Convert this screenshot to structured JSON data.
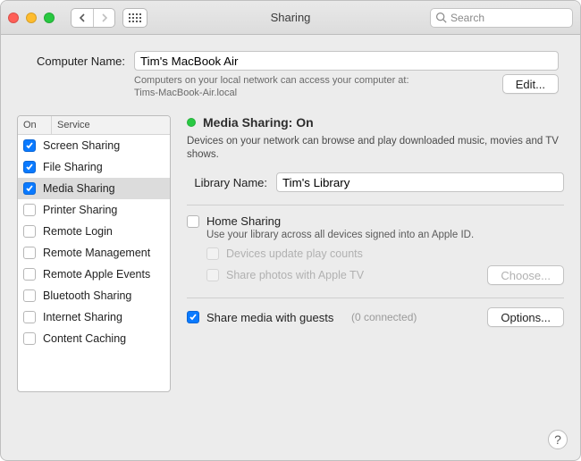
{
  "window": {
    "title": "Sharing",
    "search_placeholder": "Search"
  },
  "computer_name": {
    "label": "Computer Name:",
    "value": "Tim's MacBook Air",
    "sub1": "Computers on your local network can access your computer at:",
    "sub2": "Tims-MacBook-Air.local",
    "edit": "Edit..."
  },
  "services": {
    "col_on": "On",
    "col_service": "Service",
    "items": [
      {
        "label": "Screen Sharing",
        "on": true,
        "selected": false
      },
      {
        "label": "File Sharing",
        "on": true,
        "selected": false
      },
      {
        "label": "Media Sharing",
        "on": true,
        "selected": true
      },
      {
        "label": "Printer Sharing",
        "on": false,
        "selected": false
      },
      {
        "label": "Remote Login",
        "on": false,
        "selected": false
      },
      {
        "label": "Remote Management",
        "on": false,
        "selected": false
      },
      {
        "label": "Remote Apple Events",
        "on": false,
        "selected": false
      },
      {
        "label": "Bluetooth Sharing",
        "on": false,
        "selected": false
      },
      {
        "label": "Internet Sharing",
        "on": false,
        "selected": false
      },
      {
        "label": "Content Caching",
        "on": false,
        "selected": false
      }
    ]
  },
  "detail": {
    "status_text": "Media Sharing: On",
    "status_color": "#29c943",
    "desc": "Devices on your network can browse and play downloaded music, movies and TV shows.",
    "library_label": "Library Name:",
    "library_value": "Tim's Library",
    "home_label": "Home Sharing",
    "home_on": false,
    "home_desc": "Use your library across all devices signed into an Apple ID.",
    "sub1": {
      "label": "Devices update play counts",
      "on": false,
      "disabled": true
    },
    "sub2": {
      "label": "Share photos with Apple TV",
      "on": false,
      "disabled": true
    },
    "choose": "Choose...",
    "share_guests": {
      "label": "Share media with guests",
      "on": true
    },
    "guests_count": "(0 connected)",
    "options": "Options..."
  },
  "help": "?"
}
